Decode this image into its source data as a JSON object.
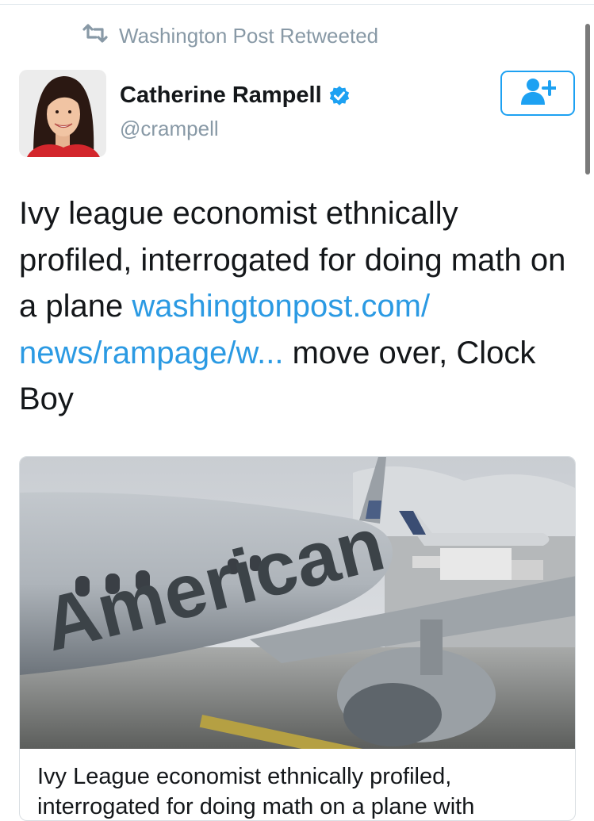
{
  "retweet": {
    "icon": "retweet-icon",
    "text": "Washington Post Retweeted"
  },
  "user": {
    "name": "Catherine Rampell",
    "handle": "@crampell",
    "verified_icon": "verified-badge-icon"
  },
  "follow": {
    "icon": "follow-user-icon"
  },
  "tweet": {
    "text_1": "Ivy league economist ethnically profiled, interrogated for doing math on a plane ",
    "link": "washingtonpost.com/ news/rampage/w...",
    "text_2": " move over, Clock Boy"
  },
  "card": {
    "image_logo": "American",
    "title": "Ivy League economist ethnically profiled, interrogated for doing math on a plane with"
  },
  "colors": {
    "accent": "#1da1f2",
    "link": "#2b9ae3",
    "muted": "#8899a6"
  }
}
